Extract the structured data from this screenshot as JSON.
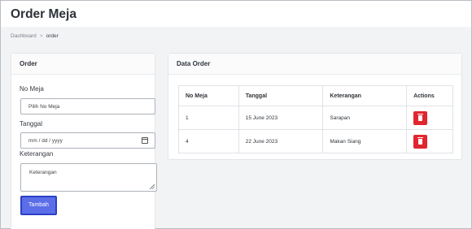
{
  "header": {
    "title": "Order Meja"
  },
  "breadcrumb": {
    "home": "Dashboard",
    "separator": ">",
    "current": "order"
  },
  "form": {
    "title": "Order",
    "no_meja_label": "No Meja",
    "no_meja_value": "Pilih No Meja",
    "tanggal_label": "Tanggal",
    "tanggal_value": "mm / dd / yyyy",
    "keterangan_label": "Keterangan",
    "keterangan_placeholder": "Keterangan",
    "submit_label": "Tambah"
  },
  "table": {
    "title": "Data Order",
    "columns": [
      "No Meja",
      "Tanggal",
      "Keterangan",
      "Actions"
    ],
    "rows": [
      {
        "no_meja": "1",
        "tanggal": "15 June 2023",
        "keterangan": "Sarapan"
      },
      {
        "no_meja": "4",
        "tanggal": "22 June 2023",
        "keterangan": "Makan Siang"
      }
    ]
  },
  "colors": {
    "primary_button": "#5b6ee8",
    "delete_button": "#e0262e",
    "background": "#f2f3f5"
  },
  "icons": {
    "delete": "trash-icon",
    "calendar": "calendar-icon"
  }
}
